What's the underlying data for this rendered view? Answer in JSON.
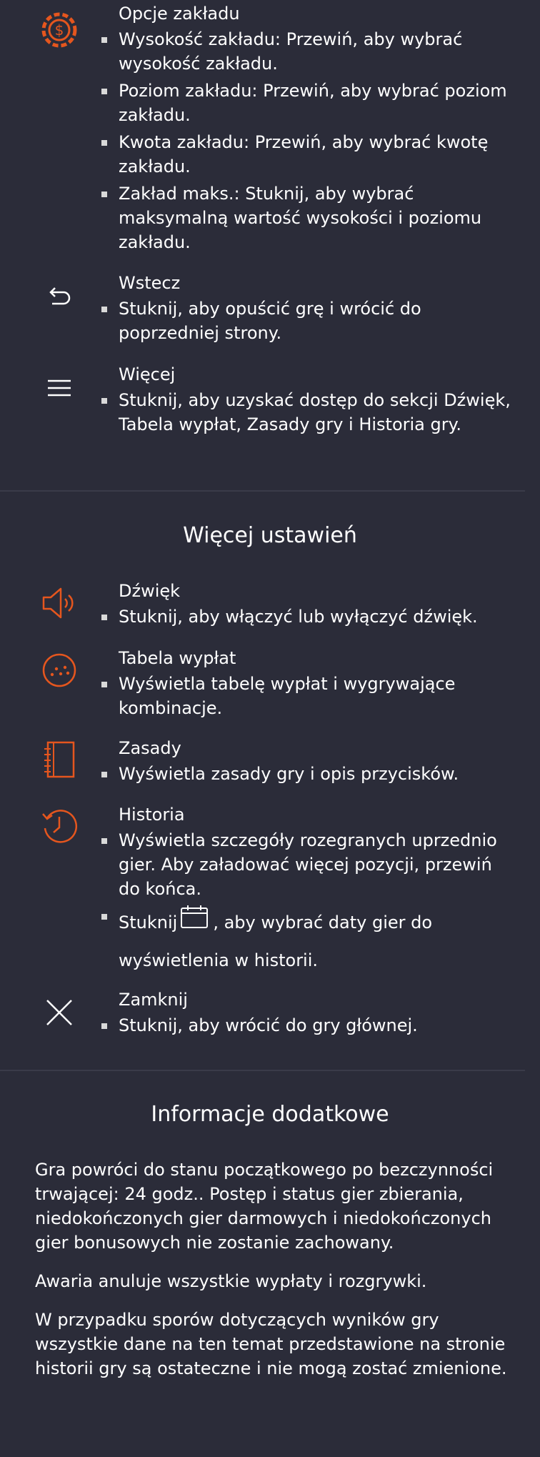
{
  "colors": {
    "background": "#2b2c39",
    "accent": "#e5561e",
    "text": "#ffffff",
    "divider": "#3a3b49"
  },
  "bet_options": {
    "icon": "dollar-chip-icon",
    "title": "Opcje zakładu",
    "bullets": [
      "Wysokość zakładu: Przewiń, aby wybrać wysokość zakładu.",
      "Poziom zakładu: Przewiń, aby wybrać poziom zakładu.",
      "Kwota zakładu: Przewiń, aby wybrać kwotę zakładu.",
      "Zakład maks.: Stuknij, aby wybrać maksymalną wartość wysokości i poziomu zakładu."
    ]
  },
  "back": {
    "icon": "back-arrow-icon",
    "title": "Wstecz",
    "bullets": [
      "Stuknij, aby opuścić grę i wrócić do poprzedniej strony."
    ]
  },
  "more": {
    "icon": "menu-icon",
    "title": "Więcej",
    "bullets": [
      "Stuknij, aby uzyskać dostęp do sekcji Dźwięk, Tabela wypłat, Zasady gry i Historia gry."
    ]
  },
  "more_settings": {
    "heading": "Więcej ustawień",
    "sound": {
      "icon": "speaker-icon",
      "title": "Dźwięk",
      "bullets": [
        "Stuknij, aby włączyć lub wyłączyć dźwięk."
      ]
    },
    "paytable": {
      "icon": "paytable-icon",
      "title": "Tabela wypłat",
      "bullets": [
        "Wyświetla tabelę wypłat i wygrywające kombinacje."
      ]
    },
    "rules": {
      "icon": "notebook-icon",
      "title": "Zasady",
      "bullets": [
        "Wyświetla zasady gry i opis przycisków."
      ]
    },
    "history": {
      "icon": "history-icon",
      "title": "Historia",
      "bullet1": "Wyświetla szczegóły rozegranych uprzednio gier. Aby załadować więcej pozycji, przewiń do końca.",
      "bullet2_before": "Stuknij",
      "bullet2_after": ", aby wybrać daty gier do wyświetlenia w historii.",
      "calendar_icon": "calendar-icon"
    },
    "close": {
      "icon": "close-icon",
      "title": "Zamknij",
      "bullets": [
        "Stuknij, aby wrócić do gry głównej."
      ]
    }
  },
  "additional_info": {
    "heading": "Informacje dodatkowe",
    "paragraphs": [
      "Gra powróci do stanu początkowego po bezczynności trwającej: 24 godz.. Postęp i status gier zbierania, niedokończonych gier darmowych i niedokończonych gier bonusowych nie zostanie zachowany.",
      "Awaria anuluje wszystkie wypłaty i rozgrywki.",
      "W przypadku sporów dotyczących wyników gry wszystkie dane na ten temat przedstawione na stronie historii gry są ostateczne i nie mogą zostać zmienione."
    ]
  }
}
